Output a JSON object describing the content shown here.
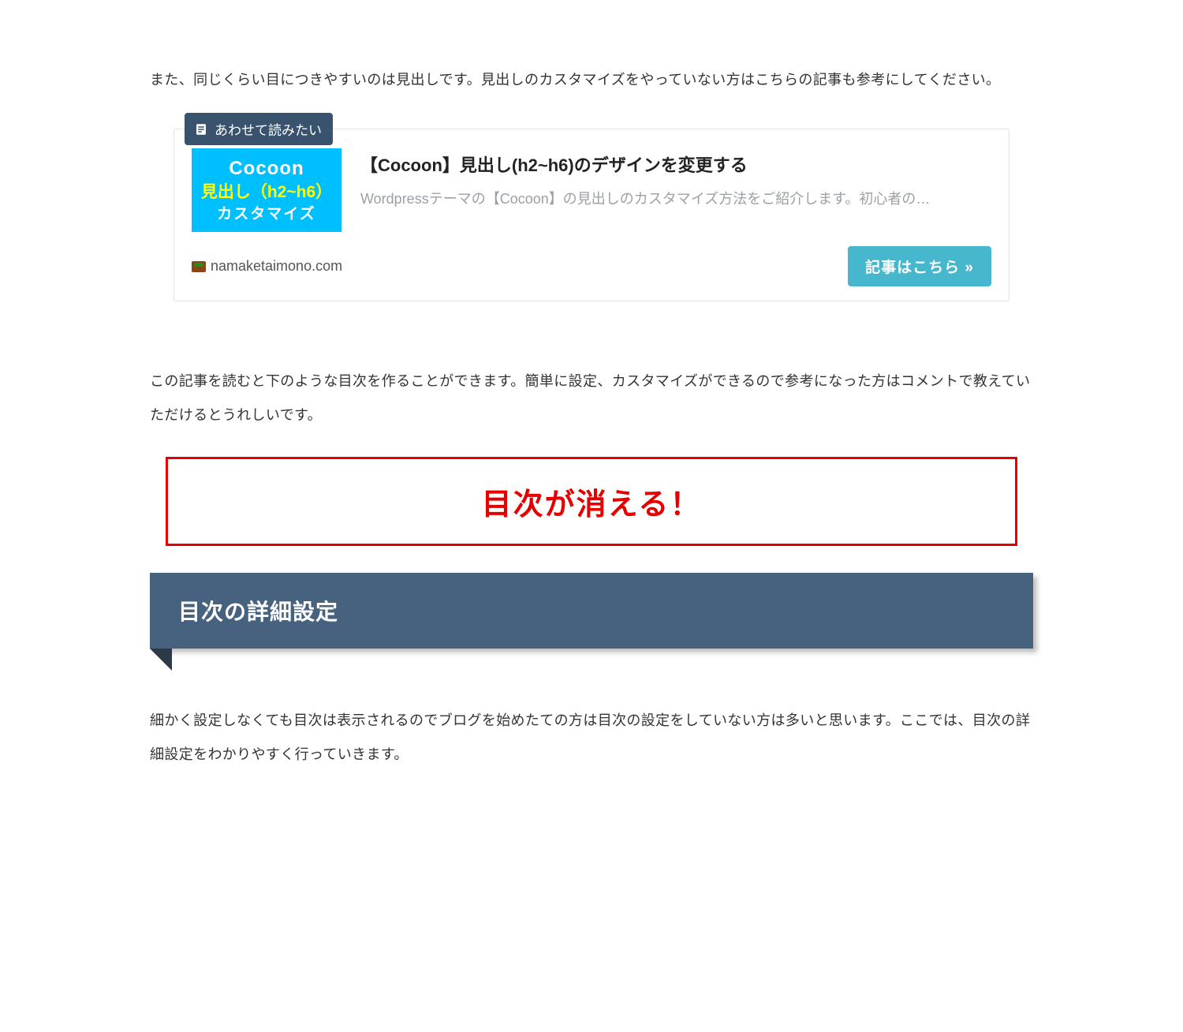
{
  "paragraph1": "また、同じくらい目につきやすいのは見出しです。見出しのカスタマイズをやっていない方はこちらの記事も参考にしてください。",
  "card": {
    "badge": "あわせて読みたい",
    "thumb": {
      "line1": "Cocoon",
      "line2": "見出し（h2~h6）",
      "line3": "カスタマイズ"
    },
    "title": "【Cocoon】見出し(h2~h6)のデザインを変更する",
    "desc": "Wordpressテーマの【Cocoon】の見出しのカスタマイズ方法をご紹介します。初心者の…",
    "domain": "namaketaimono.com",
    "cta": "記事はこちら »"
  },
  "paragraph2": "この記事を読むと下のような目次を作ることができます。簡単に設定、カスタマイズができるので参考になった方はコメントで教えていただけるとうれしいです。",
  "banner_text": "目次が消える！",
  "section_heading": "目次の詳細設定",
  "paragraph3": "細かく設定しなくても目次は表示されるのでブログを始めたての方は目次の設定をしていない方は多いと思います。ここでは、目次の詳細設定をわかりやすく行っていきます。"
}
